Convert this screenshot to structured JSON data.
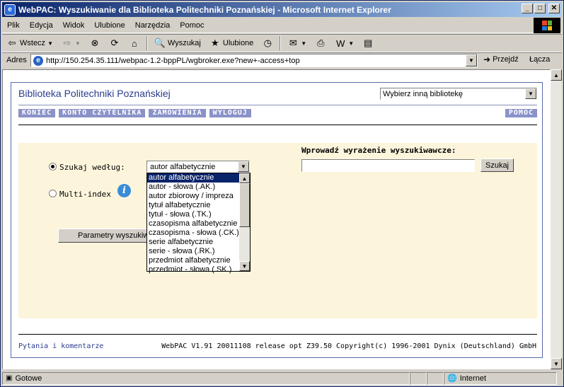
{
  "window": {
    "title": "WebPAC: Wyszukiwanie dla Biblioteka Politechniki Poznańskiej - Microsoft Internet Explorer"
  },
  "menu": [
    "Plik",
    "Edycja",
    "Widok",
    "Ulubione",
    "Narzędzia",
    "Pomoc"
  ],
  "toolbar": {
    "back": "Wstecz",
    "search": "Wyszukaj",
    "favorites": "Ulubione"
  },
  "address": {
    "label": "Adres",
    "url": "http://150.254.35.111/webpac-1.2-bppPL/wgbroker.exe?new+-access+top",
    "go": "Przejdź",
    "links": "Łącza"
  },
  "page": {
    "library_title": "Biblioteka Politechniki Poznańskiej",
    "library_select": "Wybierz inną bibliotekę",
    "nav": [
      "KONIEC",
      "KONTO CZYTELNIKA",
      "ZAMÓWIENIA",
      "WYLOGUJ"
    ],
    "nav_help": "POMOC",
    "search_by_label": "Szukaj według:",
    "multi_index_label": "Multi-index",
    "search_by_selected": "autor alfabetycznie",
    "search_options": [
      "autor alfabetycznie",
      "autor - słowa (.AK.)",
      "autor zbiorowy / impreza",
      "tytuł alfabetycznie",
      "tytuł - słowa (.TK.)",
      "czasopisma alfabetycznie",
      "czasopisma - słowa (.CK.)",
      "serie alfabetycznie",
      "serie - słowa (.RK.)",
      "przedmiot alfabetycznie",
      "przedmiot - słowa (.SK.)"
    ],
    "params_button": "Parametry wyszukiwania",
    "search_prompt": "Wprowadź wyrażenie wyszukiwawcze:",
    "search_input": "",
    "search_button": "Szukaj",
    "footer_link": "Pytania i komentarze",
    "footer_copy": "WebPAC V1.91 20011108 release opt Z39.50 Copyright(c) 1996-2001 Dynix (Deutschland) GmbH"
  },
  "status": {
    "text": "Gotowe",
    "zone": "Internet"
  }
}
